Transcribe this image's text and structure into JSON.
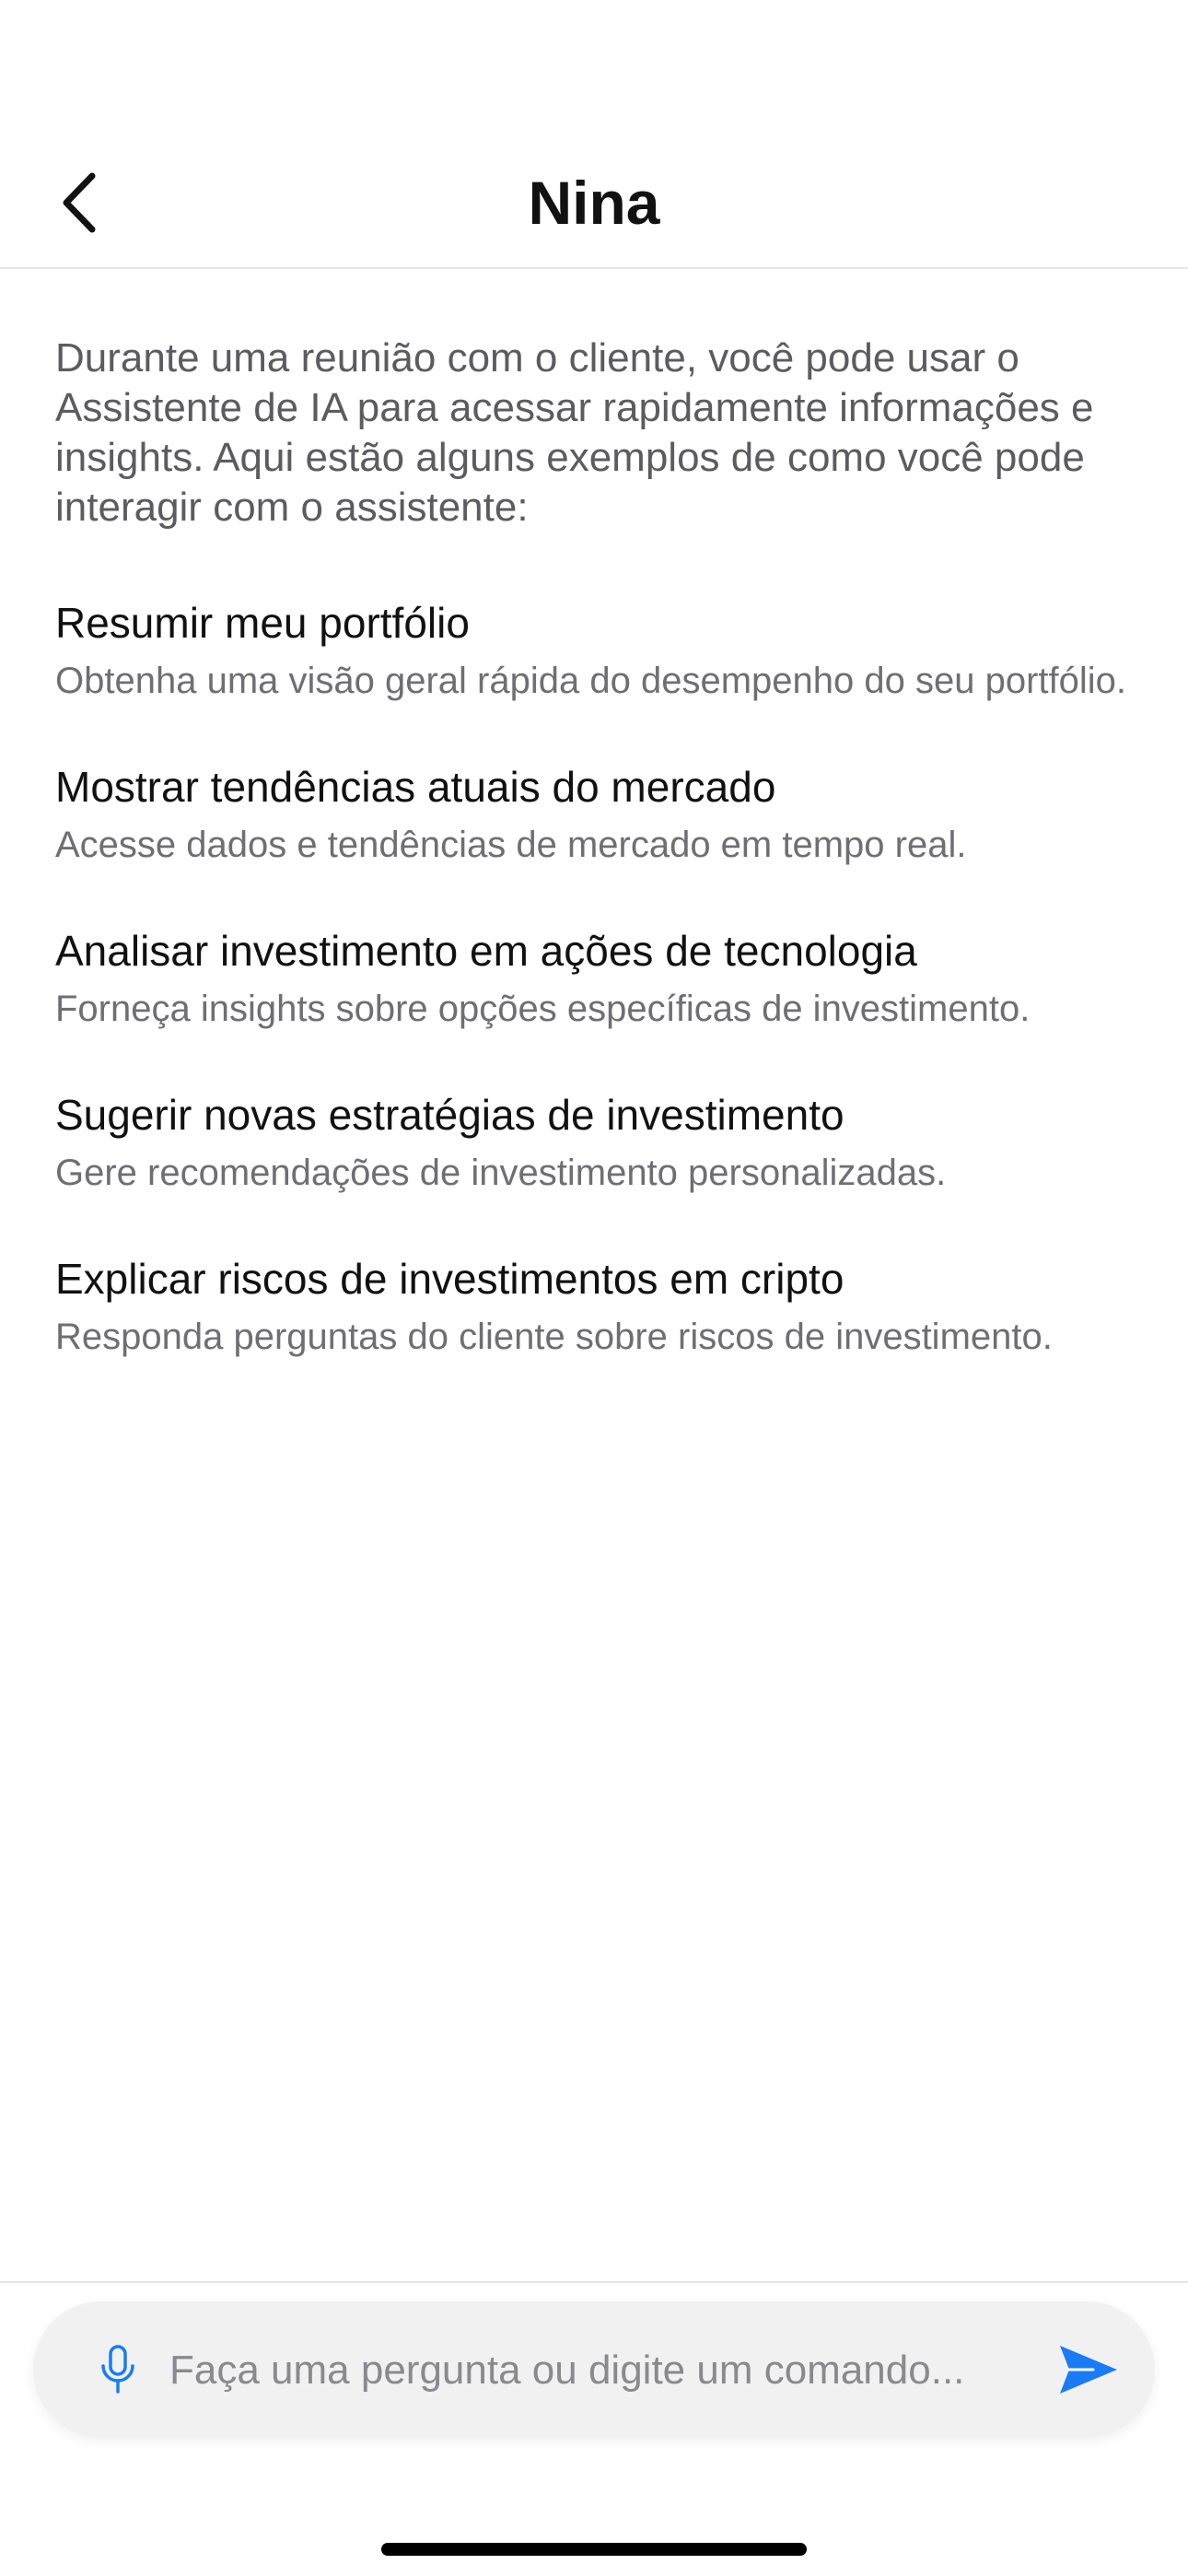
{
  "header": {
    "title": "Nina",
    "back_icon": "chevron-left-icon"
  },
  "intro": {
    "text": "Durante uma reunião com o cliente, você pode usar o Assistente de IA para acessar rapidamente informações e insights. Aqui estão alguns exemplos de como você pode interagir com o assistente:"
  },
  "suggestions": [
    {
      "title": "Resumir meu portfólio",
      "description": "Obtenha uma visão geral rápida do desempenho do seu portfólio."
    },
    {
      "title": "Mostrar tendências atuais do mercado",
      "description": "Acesse dados e tendências de mercado em tempo real."
    },
    {
      "title": "Analisar investimento em ações de tecnologia",
      "description": "Forneça insights sobre opções específicas de investimento."
    },
    {
      "title": "Sugerir novas estratégias de investimento",
      "description": "Gere recomendações de investimento personalizadas."
    },
    {
      "title": "Explicar riscos de investimentos em cripto",
      "description": "Responda perguntas do cliente sobre riscos de investimento."
    }
  ],
  "composer": {
    "placeholder": "Faça uma pergunta ou digite um comando...",
    "value": "",
    "mic_icon": "microphone-icon",
    "send_icon": "send-icon"
  },
  "colors": {
    "accent": "#1a7cf5",
    "text_primary": "#111111",
    "text_secondary": "#6f6f73",
    "composer_bg": "#f1f1f1"
  }
}
